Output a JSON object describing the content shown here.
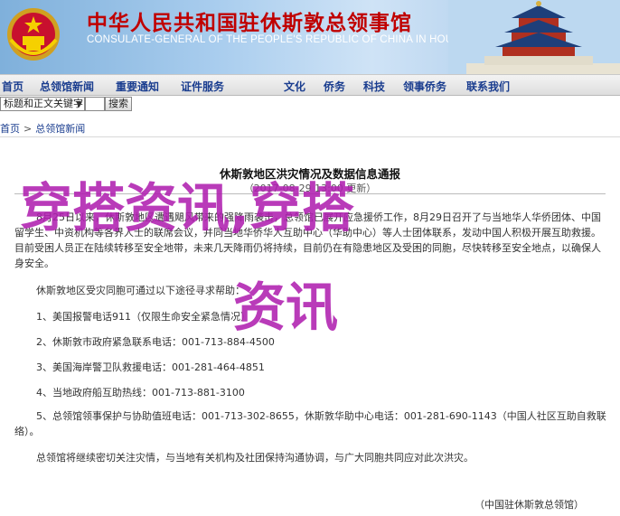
{
  "banner": {
    "title_cn": "中华人民共和国驻休斯敦总领事馆",
    "title_en": "CONSULATE-GENERAL OF THE PEOPLE'S REPUBLIC OF CHINA IN HOUSTON",
    "colors": {
      "title": "#c00000",
      "sky": "#a9cdee"
    }
  },
  "nav": {
    "items": [
      "首页",
      "总领馆新闻",
      "重要通知",
      "证件服务",
      "文化",
      "侨务",
      "科技",
      "领事侨务",
      "联系我们"
    ]
  },
  "search": {
    "scope_value": "标题和正文关键字",
    "input_value": "",
    "button_label": "搜索"
  },
  "breadcrumb": {
    "home": "首页",
    "current": "总领馆新闻"
  },
  "article": {
    "title": "休斯敦地区洪灾情况及数据信息通报",
    "date": "（2017-08-29 13:00 更新）",
    "intro": "8月25日以来，休斯敦地区遭遇飓风带来的强降雨袭击，总领馆已展开应急援侨工作，8月29日召开了与当地华人华侨团体、中国留学生、中资机构等各界人士的联席会议，并同当地华侨华人互助中心（华助中心）等人士团体联系，发动中国人积极开展互助救援。目前受困人员正在陆续转移至安全地带，未来几天降雨仍将持续，目前仍在有隐患地区及受困的同胞，尽快转移至安全地点，以确保人身安全。",
    "help_heading": "休斯敦地区受灾同胞可通过以下途径寻求帮助：",
    "items": [
      "1、美国报警电话911（仅限生命安全紧急情况）",
      "2、休斯敦市政府紧急联系电话：001-713-884-4500",
      "3、美国海岸警卫队救援电话：001-281-464-4851",
      "4、当地政府船互助热线：001-713-881-3100",
      "5、总领馆领事保护与协助值班电话：001-713-302-8655，休斯敦华助中心电话：001-281-690-1143（中国人社区互助自救联络）。"
    ],
    "closing": "总领馆将继续密切关注灾情，与当地有关机构及社团保持沟通协调，与广大同胞共同应对此次洪灾。",
    "signature": "（中国驻休斯敦总领馆）"
  },
  "overlay": {
    "line1": "穿搭资讯,穿搭",
    "line2": "资讯",
    "color": "#b020b0"
  }
}
